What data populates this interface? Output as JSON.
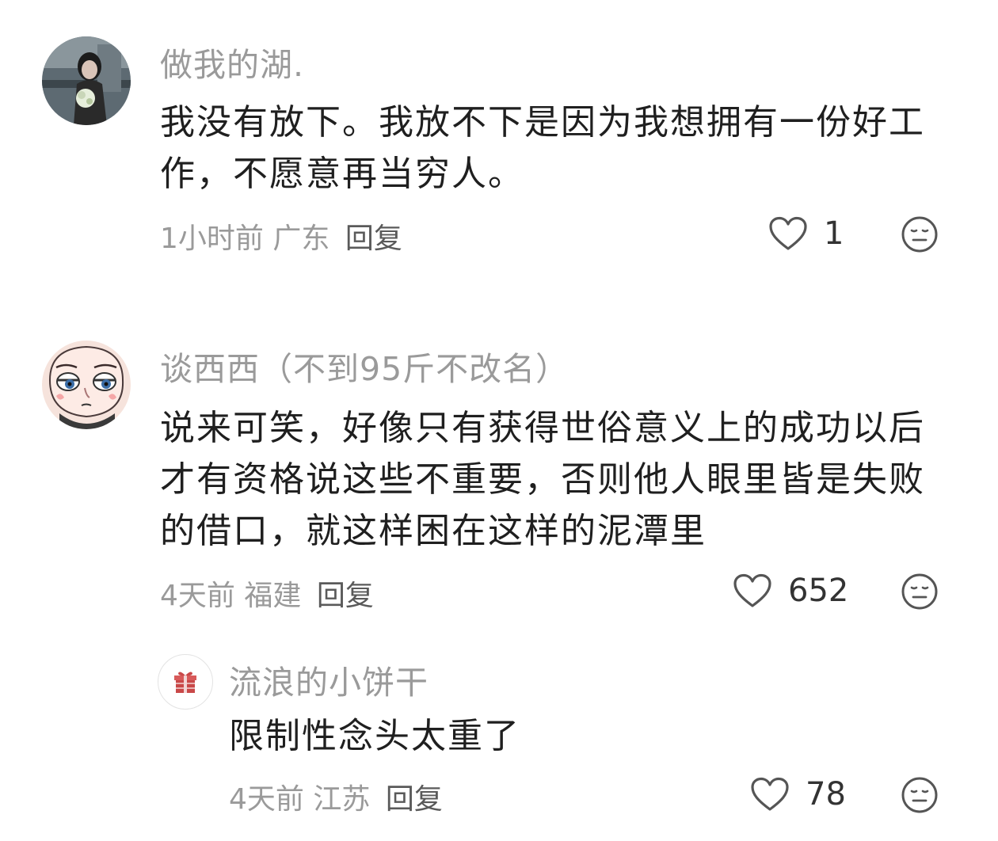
{
  "comments": [
    {
      "username": "做我的湖.",
      "text": "我没有放下。我放不下是因为我想拥有一份好工作，不愿意再当穷人。",
      "time": "1小时前",
      "location": "广东",
      "reply": "回复",
      "likes": "1",
      "avatar_icon": "person-photo-icon"
    },
    {
      "username": "谈西西（不到95斤不改名）",
      "text": "说来可笑，好像只有获得世俗意义上的成功以后才有资格说这些不重要，否则他人眼里皆是失败的借口，就这样困在这样的泥潭里",
      "time": "4天前",
      "location": "福建",
      "reply": "回复",
      "likes": "652",
      "avatar_icon": "cartoon-face-icon"
    },
    {
      "username": "流浪的小饼干",
      "text": "限制性念头太重了",
      "time": "4天前",
      "location": "江苏",
      "reply": "回复",
      "likes": "78",
      "avatar_icon": "gift-icon"
    }
  ],
  "icons": {
    "like": "heart-outline-icon",
    "dislike": "neutral-face-icon"
  },
  "colors": {
    "text": "#1f1f1f",
    "muted": "#9a9a9a",
    "reply": "#5a5a5a",
    "cheek": "#f5a7a7"
  }
}
